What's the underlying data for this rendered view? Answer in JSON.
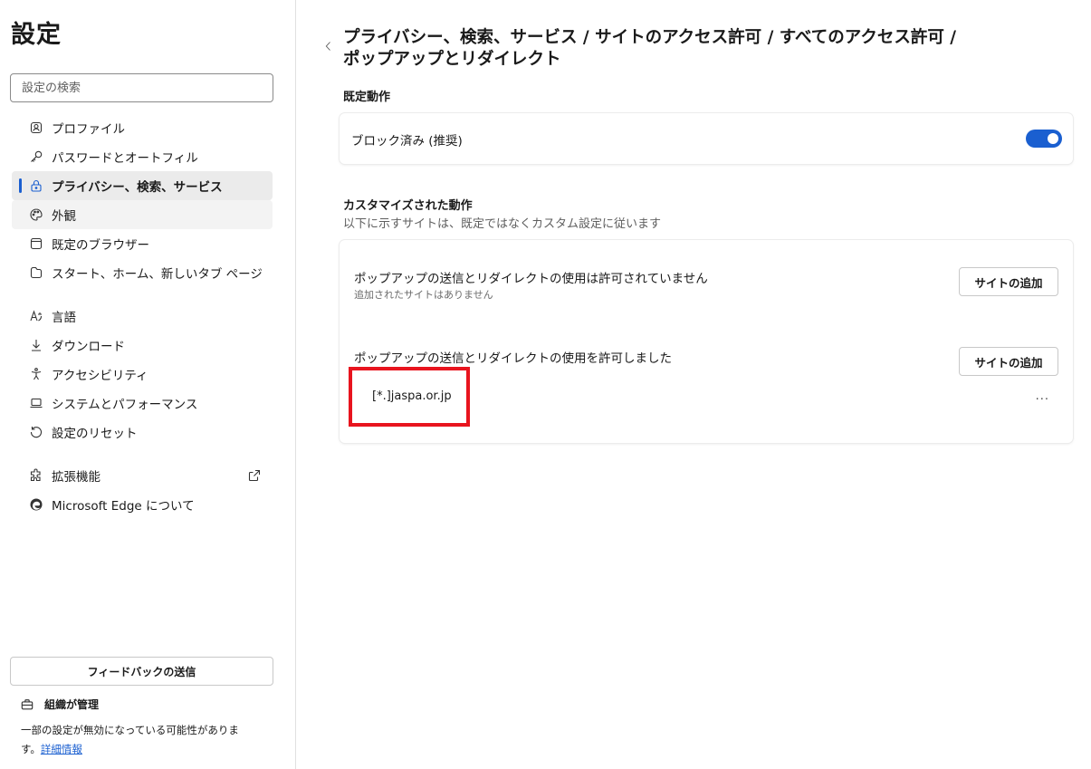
{
  "sidebar": {
    "title": "設定",
    "search_placeholder": "設定の検索",
    "items": [
      {
        "label": "プロファイル",
        "icon": "profile-icon"
      },
      {
        "label": "パスワードとオートフィル",
        "icon": "key-icon"
      },
      {
        "label": "プライバシー、検索、サービス",
        "icon": "lock-icon",
        "active": true
      },
      {
        "label": "外観",
        "icon": "palette-icon"
      },
      {
        "label": "既定のブラウザー",
        "icon": "browser-icon"
      },
      {
        "label": "スタート、ホーム、新しいタブ ページ",
        "icon": "home-page-icon"
      },
      {
        "label": "言語",
        "icon": "language-icon"
      },
      {
        "label": "ダウンロード",
        "icon": "download-icon"
      },
      {
        "label": "アクセシビリティ",
        "icon": "accessibility-icon"
      },
      {
        "label": "システムとパフォーマンス",
        "icon": "laptop-icon"
      },
      {
        "label": "設定のリセット",
        "icon": "reset-icon"
      },
      {
        "label": "拡張機能",
        "icon": "extensions-icon"
      },
      {
        "label": "Microsoft Edge について",
        "icon": "edge-icon"
      }
    ],
    "feedback_label": "フィードバックの送信",
    "managed_title": "組織が管理",
    "managed_desc": "一部の設定が無効になっている可能性がありま",
    "managed_desc2": "す。",
    "managed_link": "詳細情報"
  },
  "main": {
    "breadcrumb_line1": "プライバシー、検索、サービス / サイトのアクセス許可 / すべてのアクセス許可 /",
    "breadcrumb_line2": "ポップアップとリダイレクト",
    "default_section": {
      "title": "既定動作",
      "label": "ブロック済み (推奨)",
      "toggle_on": true
    },
    "custom_section": {
      "title": "カスタマイズされた動作",
      "subtitle": "以下に示すサイトは、既定ではなくカスタム設定に従います",
      "blocked_title": "ポップアップの送信とリダイレクトの使用は許可されていません",
      "blocked_empty": "追加されたサイトはありません",
      "allowed_title": "ポップアップの送信とリダイレクトの使用を許可しました",
      "add_site_label": "サイトの追加",
      "allowed_sites": [
        "[*.]jaspa.or.jp"
      ],
      "more_label": "..."
    }
  },
  "colors": {
    "accent": "#1a5fd0",
    "highlight": "#e8141e"
  }
}
